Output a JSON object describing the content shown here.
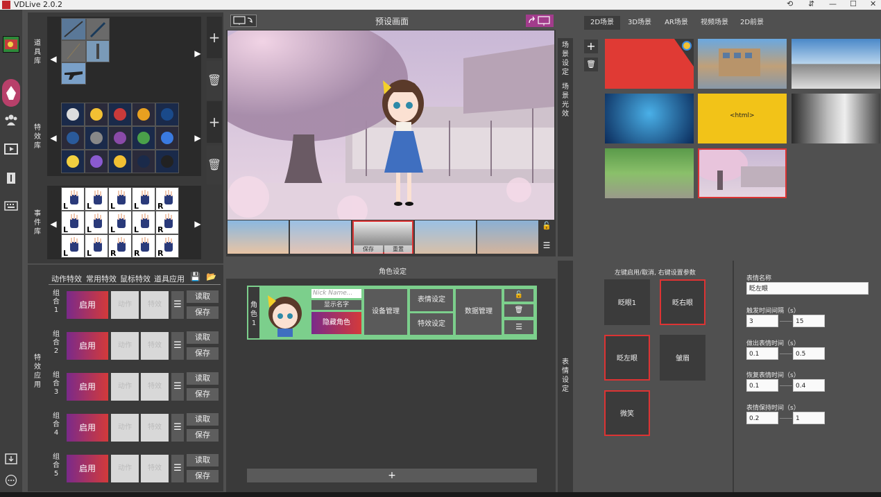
{
  "app": {
    "title": "VDLive 2.0.2"
  },
  "titlebar": {
    "minimize": "—",
    "maximize": "☐",
    "close": "✕",
    "extra1": "⟲",
    "extra2": "⇵"
  },
  "library": {
    "prop_label": "道具库",
    "effect_label": "特效库",
    "event_label": "事件库",
    "add": "+",
    "delete": "🗑"
  },
  "apply": {
    "label": "特效应用",
    "tabs": [
      "动作特效",
      "常用特效",
      "鼠标特效",
      "道具应用"
    ],
    "combos": [
      {
        "label": "组合1",
        "enable": "启用",
        "action": "动作",
        "effect": "特效",
        "read": "读取",
        "save": "保存"
      },
      {
        "label": "组合2",
        "enable": "启用",
        "action": "动作",
        "effect": "特效",
        "read": "读取",
        "save": "保存"
      },
      {
        "label": "组合3",
        "enable": "启用",
        "action": "动作",
        "effect": "特效",
        "read": "读取",
        "save": "保存"
      },
      {
        "label": "组合4",
        "enable": "启用",
        "action": "动作",
        "effect": "特效",
        "read": "读取",
        "save": "保存"
      },
      {
        "label": "组合5",
        "enable": "启用",
        "action": "动作",
        "effect": "特效",
        "read": "读取",
        "save": "保存"
      }
    ]
  },
  "preview": {
    "title": "预设画面",
    "thumb_save": "保存",
    "thumb_reset": "重置"
  },
  "sidetabs": {
    "scene_settings": "场景设定",
    "scene_light": "场景光效",
    "expr_settings": "表情设定"
  },
  "scenes": {
    "tabs": [
      "2D场景",
      "3D场景",
      "AR场景",
      "视频场景",
      "2D前景"
    ],
    "active_tab": "2D场景",
    "html_label": "<html>"
  },
  "role": {
    "title": "角色设定",
    "role_label": "角色1",
    "nick_placeholder": "Nick Name...",
    "show_name": "显示名字",
    "hide_role": "隐藏角色",
    "device_mgmt": "设备管理",
    "expr_settings": "表情设定",
    "effect_settings": "特效设定",
    "data_mgmt": "数据管理",
    "add": "+"
  },
  "expression": {
    "hint": "左键启用/取消, 右键设置参数",
    "buttons": [
      "眨眼1",
      "眨右眼",
      "眨左眼",
      "皱眉",
      "微笑"
    ],
    "name_label": "表情名称",
    "name_value": "眨左眼",
    "trigger_label": "触发时间间隔（s）",
    "trigger_min": "3",
    "trigger_max": "15",
    "out_label": "做出表情时间（s）",
    "out_min": "0.1",
    "out_max": "0.5",
    "recover_label": "恢复表情时间（s）",
    "recover_min": "0.1",
    "recover_max": "0.4",
    "hold_label": "表情保持时间（s）",
    "hold_min": "0.2",
    "hold_max": "1"
  }
}
